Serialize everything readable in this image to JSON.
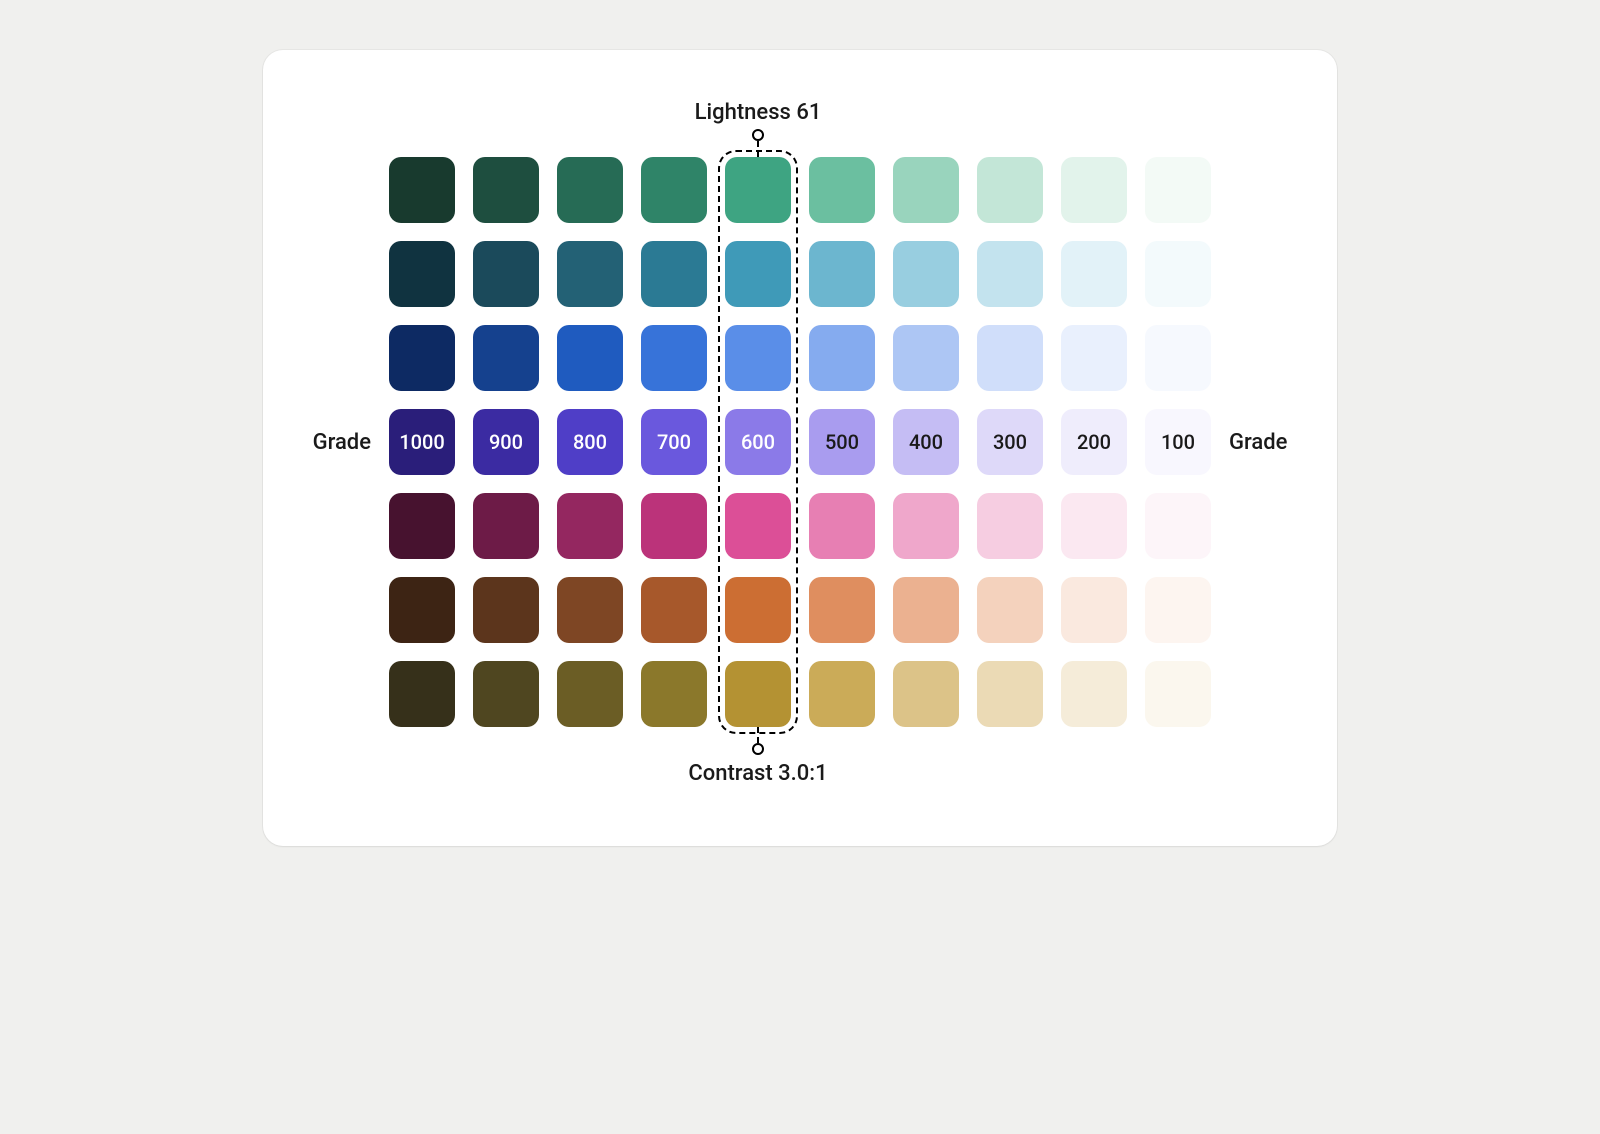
{
  "labels": {
    "top": "Lightness 61",
    "bottom": "Contrast 3.0:1",
    "side": "Grade"
  },
  "grades": [
    "1000",
    "900",
    "800",
    "700",
    "600",
    "500",
    "400",
    "300",
    "200",
    "100"
  ],
  "highlightColumnIndex": 4,
  "gradeRowIndex": 3,
  "lightTextOnGradeFromCol": 0,
  "lightTextOnGradeToCol": 4,
  "rows": [
    {
      "name": "green",
      "colors": [
        "#183a2e",
        "#1e4e3f",
        "#266b55",
        "#2f8468",
        "#3ea482",
        "#6bbfa0",
        "#99d4bd",
        "#c3e6d7",
        "#e2f3eb",
        "#f3faf6"
      ]
    },
    {
      "name": "teal-blue",
      "colors": [
        "#103340",
        "#1b4a5b",
        "#236175",
        "#2b7a94",
        "#3f9ab8",
        "#6cb6cf",
        "#98cee0",
        "#c3e3ee",
        "#e2f2f8",
        "#f3fafc"
      ]
    },
    {
      "name": "blue",
      "colors": [
        "#0d2a63",
        "#15418e",
        "#1f5bbf",
        "#3773d9",
        "#5a8ee8",
        "#85abef",
        "#adc6f4",
        "#d0defa",
        "#e9f0fd",
        "#f6f9fe"
      ]
    },
    {
      "name": "indigo",
      "colors": [
        "#2a1e7a",
        "#3b2ba2",
        "#4f3ec7",
        "#6a58dd",
        "#8b7ae8",
        "#a99cef",
        "#c5bdf4",
        "#ded9f9",
        "#efedfc",
        "#f8f7fe"
      ]
    },
    {
      "name": "magenta",
      "colors": [
        "#47122f",
        "#6d1b47",
        "#942760",
        "#bb337a",
        "#dc4f97",
        "#e77fb3",
        "#efa7cb",
        "#f6cde1",
        "#fbe8f1",
        "#fdf5f9"
      ]
    },
    {
      "name": "brown-orange",
      "colors": [
        "#3d2414",
        "#5c351c",
        "#7e4624",
        "#a7582b",
        "#cc6e33",
        "#df8e5f",
        "#ebb190",
        "#f4d2bd",
        "#fae9df",
        "#fdf5f0"
      ]
    },
    {
      "name": "olive-yellow",
      "colors": [
        "#36301a",
        "#4f4620",
        "#6b5d25",
        "#8b782b",
        "#b49233",
        "#cbab58",
        "#dcc388",
        "#ebdab5",
        "#f5ecd9",
        "#fbf7ee"
      ]
    }
  ]
}
